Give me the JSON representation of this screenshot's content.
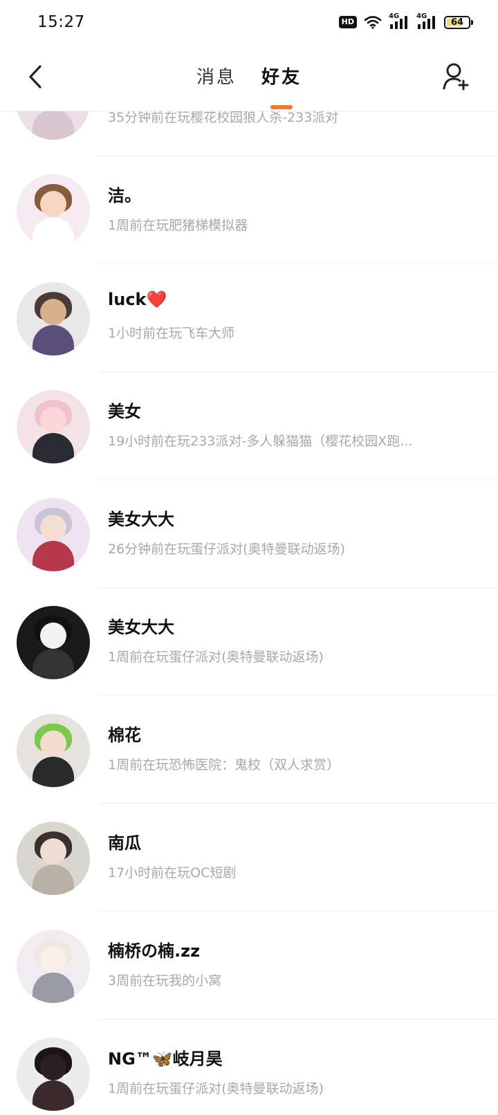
{
  "status_bar": {
    "time": "15:27",
    "hd_label": "HD",
    "network_1": "4G",
    "network_2": "4G",
    "battery": "64"
  },
  "header": {
    "tabs": [
      {
        "label": "消息",
        "active": false
      },
      {
        "label": "好友",
        "active": true
      }
    ],
    "accent_color": "#f07a2c"
  },
  "friends": [
    {
      "name": "",
      "status": "35分钟前在玩樱花校园狼人杀-233派对",
      "avatar_colors": [
        "#e9dfe4",
        "#f2e6ea",
        "#c9a9b7",
        "#d8c6cf"
      ]
    },
    {
      "name": "洁。",
      "status": "1周前在玩肥猪梯模拟器",
      "avatar_colors": [
        "#f5eaf2",
        "#f5d7c4",
        "#8a5a3c",
        "#ffffff"
      ]
    },
    {
      "name": "luck❤️",
      "status": "1小时前在玩飞车大师",
      "avatar_colors": [
        "#e8e8e8",
        "#d9b08c",
        "#4a3a3a",
        "#5a4f7a"
      ]
    },
    {
      "name": "美女",
      "status": "19小时前在玩233派对-多人躲猫猫（樱花校园X跑...",
      "avatar_colors": [
        "#f4e3e6",
        "#fbd6d9",
        "#f2c2cc",
        "#2a2a33"
      ]
    },
    {
      "name": "美女大大",
      "status": "26分钟前在玩蛋仔派对(奥特曼联动返场)",
      "avatar_colors": [
        "#efe3f2",
        "#f4ddd3",
        "#c9c3d6",
        "#b5384a"
      ]
    },
    {
      "name": "美女大大",
      "status": "1周前在玩蛋仔派对(奥特曼联动返场)",
      "avatar_colors": [
        "#1a1a1a",
        "#f2f2f2",
        "#111111",
        "#333333"
      ]
    },
    {
      "name": "棉花",
      "status": "1周前在玩恐怖医院：鬼校（双人求赏）",
      "avatar_colors": [
        "#e6e3df",
        "#f3dccf",
        "#7cc84a",
        "#2a2a2a"
      ]
    },
    {
      "name": "南瓜",
      "status": "17小时前在玩OC短剧",
      "avatar_colors": [
        "#d9d5cf",
        "#efddd4",
        "#3a302c",
        "#b9b0a6"
      ]
    },
    {
      "name": "楠桥の楠.zz",
      "status": "3周前在玩我的小窝",
      "avatar_colors": [
        "#f0ecf2",
        "#fbefe9",
        "#efe7e2",
        "#9a9aa6"
      ]
    },
    {
      "name": "NG™🦋岐月昊",
      "status": "1周前在玩蛋仔派对(奥特曼联动返场)",
      "avatar_colors": [
        "#ececec",
        "#2b2022",
        "#1c1416",
        "#3a2a2e"
      ]
    }
  ]
}
